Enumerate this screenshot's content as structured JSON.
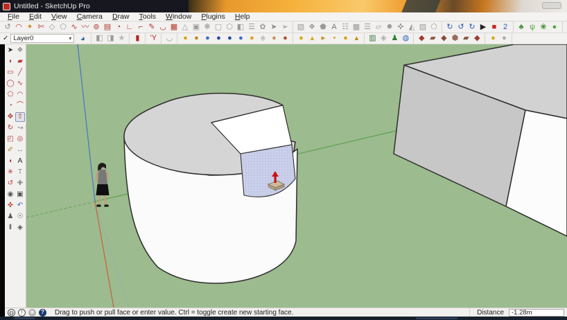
{
  "window": {
    "title": "Untitled - SketchUp Pro"
  },
  "menu": {
    "items": [
      "File",
      "Edit",
      "View",
      "Camera",
      "Draw",
      "Tools",
      "Window",
      "Plugins",
      "Help"
    ]
  },
  "toolbar1": {
    "groups": [
      {
        "name": "draw-modify-tools",
        "icons": [
          {
            "n": "offset-arc",
            "g": "↺",
            "c": "#8a8a8a"
          },
          {
            "n": "two-point-arc",
            "g": "◠",
            "c": "#b4392f"
          },
          {
            "n": "paint-splash",
            "g": "✦",
            "c": "#d98a2b"
          },
          {
            "n": "cut",
            "g": "✄",
            "c": "#b4392f"
          },
          {
            "n": "shape",
            "g": "◇",
            "c": "#9a9a9a"
          },
          {
            "n": "polygon",
            "g": "⬠",
            "c": "#9a9a9a"
          },
          {
            "n": "freehand",
            "g": "∿",
            "c": "#b4392f"
          },
          {
            "n": "squiggle",
            "g": "〰",
            "c": "#b4392f"
          },
          {
            "n": "circle-mark",
            "g": "⊚",
            "c": "#b4392f"
          },
          {
            "n": "box-face",
            "g": "▤",
            "c": "#b4392f"
          },
          {
            "n": "pie",
            "g": "◔",
            "c": "#b4392f"
          },
          {
            "n": "corner",
            "g": "∟",
            "c": "#b4392f"
          },
          {
            "n": "corner-flip",
            "g": "⌐",
            "c": "#b4392f"
          },
          {
            "n": "pencil",
            "g": "✎",
            "c": "#b4392f"
          },
          {
            "n": "arc-down",
            "g": "◡",
            "c": "#b4392f"
          },
          {
            "n": "grid-face",
            "g": "▦",
            "c": "#b4392f"
          },
          {
            "n": "set-square",
            "g": "△",
            "c": "#9a9a9a"
          },
          {
            "n": "solid-box",
            "g": "▣",
            "c": "#9a9a9a"
          },
          {
            "n": "flower-gear",
            "g": "❋",
            "c": "#9a9a9a"
          },
          {
            "n": "blank-face",
            "g": "▢",
            "c": "#9a9a9a"
          },
          {
            "n": "hex-prism",
            "g": "⬡",
            "c": "#9a9a9a"
          },
          {
            "n": "half-box",
            "g": "◧",
            "c": "#9a9a9a"
          },
          {
            "n": "stack",
            "g": "☰",
            "c": "#9a9a9a"
          },
          {
            "n": "leaf",
            "g": "✿",
            "c": "#9a9a9a"
          },
          {
            "n": "arrow-a",
            "g": "➤",
            "c": "#8a8a8a"
          },
          {
            "n": "arrow-b",
            "g": "➢",
            "c": "#8a8a8a"
          }
        ]
      },
      {
        "name": "solid-tools",
        "icons": [
          {
            "n": "image",
            "g": "▧",
            "c": "#9a9a9a"
          },
          {
            "n": "shapes",
            "g": "❖",
            "c": "#9a9a9a"
          },
          {
            "n": "outline",
            "g": "⬟",
            "c": "#9a9a9a"
          },
          {
            "n": "letter-a",
            "g": "A",
            "c": "#777777"
          },
          {
            "n": "sheets",
            "g": "☷",
            "c": "#9a9a9a"
          },
          {
            "n": "waffle",
            "g": "▩",
            "c": "#9a9a9a"
          },
          {
            "n": "ribs",
            "g": "☰",
            "c": "#9a9a9a"
          },
          {
            "n": "sheet",
            "g": "▱",
            "c": "#9a9a9a"
          },
          {
            "n": "fan",
            "g": "✹",
            "c": "#9a9a9a"
          },
          {
            "n": "gear",
            "g": "✜",
            "c": "#9a9a9a"
          },
          {
            "n": "wedge",
            "g": "◭",
            "c": "#9a9a9a"
          },
          {
            "n": "striped-box",
            "g": "▨",
            "c": "#9a9a9a"
          },
          {
            "n": "pentagon",
            "g": "⬠",
            "c": "#9a9a9a"
          }
        ]
      },
      {
        "name": "animation-tools",
        "icons": [
          {
            "n": "scene-spin-1",
            "g": "↻",
            "c": "#2b58b8"
          },
          {
            "n": "scene-spin-2",
            "g": "↺",
            "c": "#2b58b8"
          },
          {
            "n": "scene-spin-3",
            "g": "↻",
            "c": "#2b58b8"
          },
          {
            "n": "play",
            "g": "▶",
            "c": "#222222"
          },
          {
            "n": "record",
            "g": "■",
            "c": "#cc2222"
          },
          {
            "n": "animation-2",
            "g": "2",
            "c": "#2b58b8"
          }
        ]
      },
      {
        "name": "vegetation-tools",
        "icons": [
          {
            "n": "plant",
            "g": "♣",
            "c": "#3f8f2f"
          },
          {
            "n": "grass",
            "g": "ψ",
            "c": "#4f9f3f"
          },
          {
            "n": "leaf-ball",
            "g": "❀",
            "c": "#3f8f2f"
          },
          {
            "n": "sprout",
            "g": "●",
            "c": "#56a546"
          }
        ]
      }
    ]
  },
  "toolbar2": {
    "layers": {
      "check": "✓",
      "name": "Layer0",
      "arrow": "▾",
      "manager_glyph": "◕"
    },
    "groups": [
      {
        "name": "modify-tools",
        "icons": [
          {
            "n": "push-left",
            "g": "◧",
            "c": "#9a9a9a"
          },
          {
            "n": "push-up",
            "g": "◨",
            "c": "#9a9a9a"
          },
          {
            "n": "star",
            "g": "✭",
            "c": "#9a9a9a"
          }
        ]
      },
      {
        "name": "library",
        "icons": [
          {
            "n": "red-book",
            "g": "▮",
            "c": "#b22222"
          }
        ]
      },
      {
        "name": "text-y",
        "icons": [
          {
            "n": "y-tool",
            "g": "'Y",
            "c": "#cc2222"
          }
        ]
      },
      {
        "name": "arc-group",
        "icons": [
          {
            "n": "flip-arc",
            "g": "◡",
            "c": "#9a9a9a"
          }
        ]
      },
      {
        "name": "sphere-plugins",
        "icons": [
          {
            "n": "gold-sphere-1",
            "g": "●",
            "c": "#d9a520"
          },
          {
            "n": "gold-sphere-2",
            "g": "●",
            "c": "#c18a1a"
          },
          {
            "n": "blue-sphere-1",
            "g": "●",
            "c": "#3f6cc0"
          },
          {
            "n": "navy-sphere-1",
            "g": "●",
            "c": "#27459a"
          },
          {
            "n": "navy-sphere-2",
            "g": "●",
            "c": "#27459a"
          },
          {
            "n": "blue-sphere-2",
            "g": "●",
            "c": "#3f6cc0"
          },
          {
            "n": "gold-sphere-3",
            "g": "●",
            "c": "#d9a520"
          },
          {
            "n": "white-diamond",
            "g": "◈",
            "c": "#bbbbbb"
          },
          {
            "n": "tan-sphere",
            "g": "●",
            "c": "#c59a5f"
          },
          {
            "n": "rust-sphere",
            "g": "●",
            "c": "#b2502e"
          }
        ]
      },
      {
        "name": "small-tools",
        "icons": [
          {
            "n": "gold-dot-1",
            "g": "●",
            "c": "#d9a520"
          },
          {
            "n": "pin-1",
            "g": "▴",
            "c": "#d9a520"
          },
          {
            "n": "pin-2",
            "g": "▸",
            "c": "#c18a1a"
          },
          {
            "n": "gold-dot-2",
            "g": "•",
            "c": "#d9a520"
          },
          {
            "n": "gold-dot-3",
            "g": "●",
            "c": "#d9a520"
          },
          {
            "n": "pin-3",
            "g": "▴",
            "c": "#c18a1a"
          }
        ]
      },
      {
        "name": "scene-plugins",
        "icons": [
          {
            "n": "tree-window",
            "g": "▥",
            "c": "#3a7d3a"
          },
          {
            "n": "gem",
            "g": "◈",
            "c": "#aaaaaa"
          },
          {
            "n": "green-figure",
            "g": "♟",
            "c": "#2f7d2f"
          },
          {
            "n": "earth-globe",
            "g": "◍",
            "c": "#2d66b8"
          }
        ]
      },
      {
        "name": "brick-plugins",
        "icons": [
          {
            "n": "brick-1",
            "g": "◆",
            "c": "#a03a2f"
          },
          {
            "n": "brick-2",
            "g": "▰",
            "c": "#8a5a4a"
          },
          {
            "n": "brick-3",
            "g": "◆",
            "c": "#8a4a3a"
          },
          {
            "n": "brick-4",
            "g": "⬢",
            "c": "#9a6a5a"
          },
          {
            "n": "brick-5",
            "g": "▰",
            "c": "#8a5a4a"
          },
          {
            "n": "brick-6",
            "g": "◆",
            "c": "#a03a2f"
          }
        ]
      },
      {
        "name": "ball-plugins",
        "icons": [
          {
            "n": "gold-ball",
            "g": "●",
            "c": "#d9a520"
          },
          {
            "n": "gray-ball",
            "g": "●",
            "c": "#aaaaaa"
          }
        ]
      }
    ]
  },
  "left_tools": {
    "rows": [
      [
        {
          "n": "select",
          "g": "➤",
          "c": "#2a2a2a"
        },
        {
          "n": "make-component",
          "g": "❖",
          "c": "#8a8a8a"
        }
      ],
      [
        {
          "n": "paint-bucket",
          "g": "◗",
          "c": "#b4392f"
        },
        {
          "n": "eraser",
          "g": "▰",
          "c": "#b4392f"
        }
      ],
      [
        {
          "n": "rectangle",
          "g": "▭",
          "c": "#b4392f"
        },
        {
          "n": "line",
          "g": "╱",
          "c": "#b4392f"
        }
      ],
      [
        {
          "n": "circle",
          "g": "◯",
          "c": "#b4392f"
        },
        {
          "n": "freehand",
          "g": "∿",
          "c": "#b4392f"
        }
      ],
      [
        {
          "n": "polygon",
          "g": "⬠",
          "c": "#b4392f"
        },
        {
          "n": "arc",
          "g": "◠",
          "c": "#b4392f"
        }
      ],
      [
        {
          "n": "pie",
          "g": "◔",
          "c": "#b4392f"
        },
        {
          "n": "bezier",
          "g": "⌒",
          "c": "#b4392f"
        }
      ],
      [
        {
          "n": "move",
          "g": "✥",
          "c": "#b4392f"
        },
        {
          "n": "push-pull",
          "g": "⇧",
          "c": "#b4392f",
          "active": true
        }
      ],
      [
        {
          "n": "rotate",
          "g": "↻",
          "c": "#b4392f"
        },
        {
          "n": "follow-me",
          "g": "↝",
          "c": "#8a8a8a"
        }
      ],
      [
        {
          "n": "scale",
          "g": "◰",
          "c": "#b4392f"
        },
        {
          "n": "offset",
          "g": "◎",
          "c": "#b4392f"
        }
      ],
      [
        {
          "n": "tape-measure",
          "g": "✐",
          "c": "#b08a2a"
        },
        {
          "n": "dimension",
          "g": "↔",
          "c": "#8a8a8a"
        }
      ],
      [
        {
          "n": "protractor",
          "g": "◖",
          "c": "#b4392f"
        },
        {
          "n": "text",
          "g": "A",
          "c": "#2a2a2a"
        }
      ],
      [
        {
          "n": "axes",
          "g": "✳",
          "c": "#b4392f"
        },
        {
          "n": "3d-text",
          "g": "T",
          "c": "#8a8a8a"
        }
      ],
      [
        {
          "n": "orbit",
          "g": "↺",
          "c": "#c03a3a"
        },
        {
          "n": "pan",
          "g": "✚",
          "c": "#8a8a8a"
        }
      ],
      [
        {
          "n": "zoom",
          "g": "◉",
          "c": "#555555"
        },
        {
          "n": "zoom-window",
          "g": "▣",
          "c": "#555555"
        }
      ],
      [
        {
          "n": "zoom-extents",
          "g": "✜",
          "c": "#b4392f"
        },
        {
          "n": "previous",
          "g": "↶",
          "c": "#3a6ab8"
        }
      ],
      [
        {
          "n": "position-camera",
          "g": "♟",
          "c": "#555555"
        },
        {
          "n": "look-around",
          "g": "☉",
          "c": "#555555"
        }
      ],
      [
        {
          "n": "walk",
          "g": "‖",
          "c": "#2a2a2a"
        },
        {
          "n": "section-plane",
          "g": "◈",
          "c": "#555555"
        }
      ]
    ]
  },
  "viewport": {
    "colors": {
      "background": "#9CBB8E",
      "cylinder_top": "#D5D5D5",
      "cylinder_body": "#FBFBFB",
      "cut_face": "#FFFFFF",
      "selected_face": "#CBD0EA",
      "box_top": "#D2D2D2",
      "box_front": "#C7C7C7",
      "box_side": "#FCFCFC",
      "edge": "#2E2E2E",
      "axis_blue": "#4A72C8",
      "axis_red": "#C9603B",
      "axis_green": "#5FA054"
    }
  },
  "status": {
    "icons": [
      {
        "n": "geolocation",
        "g": "◍",
        "t": "outline"
      },
      {
        "n": "model-info",
        "g": "!",
        "t": "outline"
      },
      {
        "n": "sign-in",
        "g": "☻",
        "t": "gray"
      },
      {
        "n": "help",
        "g": "?",
        "t": "navy"
      }
    ],
    "message": "Drag to push or pull face or enter value.  Ctrl = toggle create new starting face.",
    "distance_label": "Distance",
    "distance_value": "-1.28m"
  }
}
